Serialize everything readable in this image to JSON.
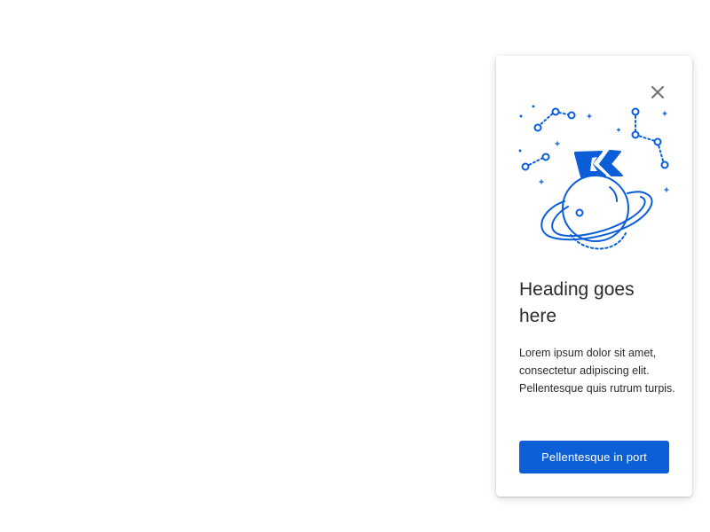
{
  "card": {
    "illustration_icon": "planet-flag-constellation-illustration",
    "close_icon": "close-icon",
    "heading": "Heading goes here",
    "body": "Lorem ipsum dolor sit amet, consectetur adipiscing elit. Pellentesque quis rutrum turpis.",
    "button_label": "Pellentesque in port"
  },
  "colors": {
    "accent": "#0d5fd7",
    "illustration": "#0b5ed7",
    "text": "#2b2b2b",
    "close_icon": "#6f6f6f",
    "background": "#ffffff"
  }
}
